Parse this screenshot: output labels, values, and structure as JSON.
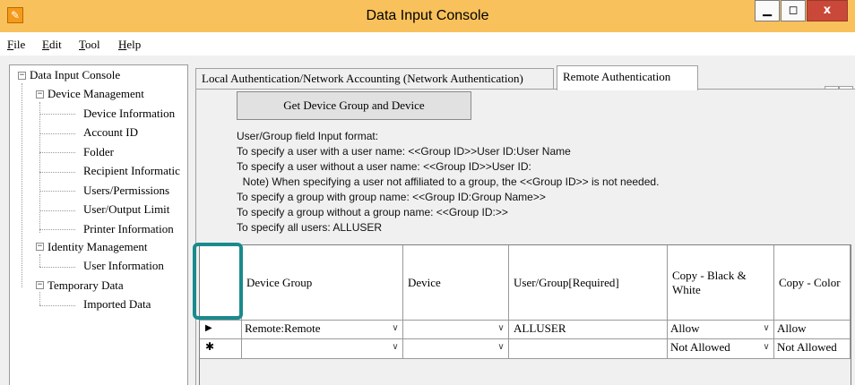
{
  "window": {
    "title": "Data Input Console",
    "app_icon_glyph": "✎",
    "minimize_glyph": "▁",
    "maximize_glyph": "◻",
    "close_glyph": "x",
    "title_color": "#f9c15b",
    "close_color": "#c9483a"
  },
  "menu": {
    "items": [
      "File",
      "Edit",
      "Tool",
      "Help"
    ]
  },
  "tree": {
    "collapse_glyph": "−",
    "root": "Data Input Console",
    "nodes": [
      {
        "label": "Device Management",
        "children": [
          "Device Information",
          "Account ID",
          "Folder",
          "Recipient Informatic",
          "Users/Permissions",
          "User/Output Limit",
          "Printer Information"
        ]
      },
      {
        "label": "Identity Management",
        "children": [
          "User Information"
        ]
      },
      {
        "label": "Temporary Data",
        "children": [
          "Imported Data"
        ]
      }
    ]
  },
  "tabs": {
    "items": [
      {
        "label": "Local Authentication/Network Accounting (Network Authentication)",
        "active": false
      },
      {
        "label": "Remote Authentication",
        "active": true
      }
    ],
    "scroll_left_glyph": "‹",
    "scroll_right_glyph": "›"
  },
  "panel": {
    "get_button_label": "Get Device Group and Device",
    "info_lines": [
      "User/Group field Input format:",
      "To specify a user with a user name: <<Group ID>>User ID:User Name",
      "To specify a user without a user name: <<Group ID>>User ID:",
      "  Note) When specifying a user not affiliated to a group, the <<Group ID>> is not needed.",
      "To specify a group with group name: <<Group ID:Group Name>>",
      "To specify a group without a group name: <<Group ID:>>",
      "To specify all users: ALLUSER"
    ]
  },
  "grid": {
    "columns": [
      "",
      "Device Group",
      "Device",
      "User/Group[Required]",
      "Copy - Black & White",
      "Copy - Color"
    ],
    "current_row_glyph": "▶",
    "new_row_glyph": "✱",
    "dropdown_glyph": "∨",
    "rows": [
      {
        "marker": "current",
        "device_group": "Remote:Remote",
        "device": "",
        "user_group": "ALLUSER",
        "copy_bw": "Allow",
        "copy_color": "Allow"
      },
      {
        "marker": "new",
        "device_group": "",
        "device": "",
        "user_group": "",
        "copy_bw": "Not Allowed",
        "copy_color": "Not Allowed"
      }
    ],
    "highlight_color": "#1a8a8c"
  }
}
